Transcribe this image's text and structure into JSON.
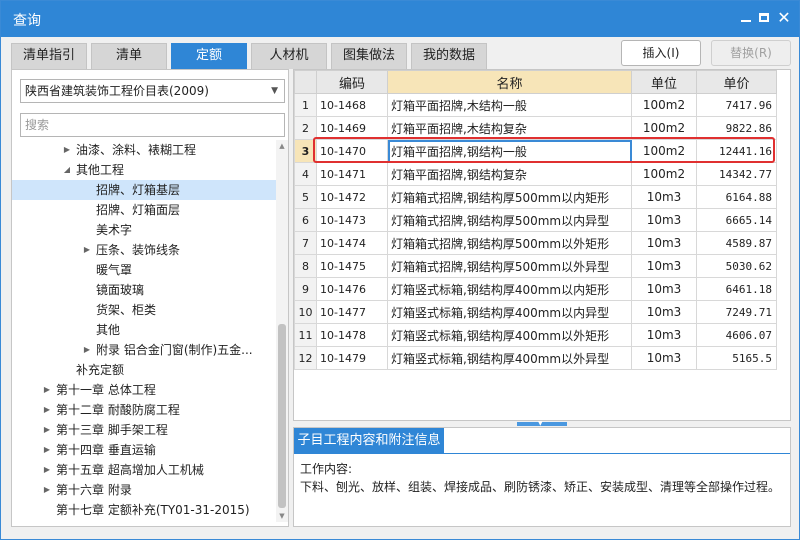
{
  "window": {
    "title": "查询",
    "min_label": "",
    "close_label": "✕"
  },
  "tabs": [
    {
      "label": "清单指引",
      "active": false
    },
    {
      "label": "清单",
      "active": false
    },
    {
      "label": "定额",
      "active": true
    },
    {
      "label": "人材机",
      "active": false
    },
    {
      "label": "图集做法",
      "active": false
    },
    {
      "label": "我的数据",
      "active": false
    }
  ],
  "actions": {
    "insert_label": "插入(I)",
    "replace_label": "替换(R)"
  },
  "left": {
    "library": "陕西省建筑装饰工程价目表(2009)",
    "search_placeholder": "搜索",
    "tree": [
      {
        "label": "油漆、涂料、裱糊工程",
        "expander": "▶"
      },
      {
        "label": "其他工程",
        "expander": "◢"
      },
      {
        "label": "招牌、灯箱基层",
        "expander": ""
      },
      {
        "label": "招牌、灯箱面层",
        "expander": ""
      },
      {
        "label": "美术字",
        "expander": ""
      },
      {
        "label": "压条、装饰线条",
        "expander": "▶"
      },
      {
        "label": "暖气罩",
        "expander": ""
      },
      {
        "label": "镜面玻璃",
        "expander": ""
      },
      {
        "label": "货架、柜类",
        "expander": ""
      },
      {
        "label": "其他",
        "expander": ""
      },
      {
        "label": "附录 铝合金门窗(制作)五金...",
        "expander": "▶"
      },
      {
        "label": "补充定额",
        "expander": ""
      },
      {
        "label": "第十一章 总体工程",
        "expander": "▶"
      },
      {
        "label": "第十二章 耐酸防腐工程",
        "expander": "▶"
      },
      {
        "label": "第十三章 脚手架工程",
        "expander": "▶"
      },
      {
        "label": "第十四章 垂直运输",
        "expander": "▶"
      },
      {
        "label": "第十五章 超高增加人工机械",
        "expander": "▶"
      },
      {
        "label": "第十六章 附录",
        "expander": "▶"
      },
      {
        "label": "第十七章 定额补充(TY01-31-2015)",
        "expander": ""
      }
    ]
  },
  "grid": {
    "headers": [
      "",
      "编码",
      "名称",
      "单位",
      "单价"
    ],
    "rows": [
      {
        "n": "1",
        "code": "10-1468",
        "name": "灯箱平面招牌,木结构一般",
        "unit": "100m2",
        "price": "7417.96"
      },
      {
        "n": "2",
        "code": "10-1469",
        "name": "灯箱平面招牌,木结构复杂",
        "unit": "100m2",
        "price": "9822.86"
      },
      {
        "n": "3",
        "code": "10-1470",
        "name": "灯箱平面招牌,钢结构一般",
        "unit": "100m2",
        "price": "12441.16"
      },
      {
        "n": "4",
        "code": "10-1471",
        "name": "灯箱平面招牌,钢结构复杂",
        "unit": "100m2",
        "price": "14342.77"
      },
      {
        "n": "5",
        "code": "10-1472",
        "name": "灯箱箱式招牌,钢结构厚500mm以内矩形",
        "unit": "10m3",
        "price": "6164.88"
      },
      {
        "n": "6",
        "code": "10-1473",
        "name": "灯箱箱式招牌,钢结构厚500mm以内异型",
        "unit": "10m3",
        "price": "6665.14"
      },
      {
        "n": "7",
        "code": "10-1474",
        "name": "灯箱箱式招牌,钢结构厚500mm以外矩形",
        "unit": "10m3",
        "price": "4589.87"
      },
      {
        "n": "8",
        "code": "10-1475",
        "name": "灯箱箱式招牌,钢结构厚500mm以外异型",
        "unit": "10m3",
        "price": "5030.62"
      },
      {
        "n": "9",
        "code": "10-1476",
        "name": "灯箱竖式标箱,钢结构厚400mm以内矩形",
        "unit": "10m3",
        "price": "6461.18"
      },
      {
        "n": "10",
        "code": "10-1477",
        "name": "灯箱竖式标箱,钢结构厚400mm以内异型",
        "unit": "10m3",
        "price": "7249.71"
      },
      {
        "n": "11",
        "code": "10-1478",
        "name": "灯箱竖式标箱,钢结构厚400mm以外矩形",
        "unit": "10m3",
        "price": "4606.07"
      },
      {
        "n": "12",
        "code": "10-1479",
        "name": "灯箱竖式标箱,钢结构厚400mm以外异型",
        "unit": "10m3",
        "price": "5165.5"
      }
    ]
  },
  "info": {
    "tab_label": "子目工程内容和附注信息",
    "heading": "工作内容:",
    "content": "下料、刨光、放样、组装、焊接成品、刷防锈漆、矫正、安装成型、清理等全部操作过程。"
  },
  "colors": {
    "accent": "#2f86d6",
    "highlight": "#e03030",
    "selection": "#cfe5fb"
  }
}
